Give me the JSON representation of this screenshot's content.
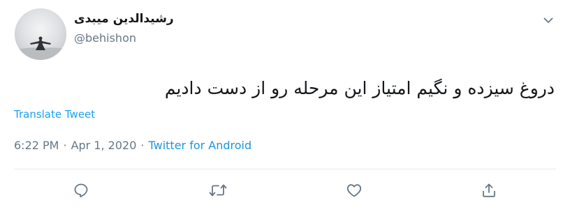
{
  "user": {
    "display_name": "رشیدالدین میبدی",
    "handle": "@behishon"
  },
  "tweet": {
    "text": "دروغ سیزده و نگیم امتیاز این مرحله رو از دست دادیم",
    "translate_label": "Translate Tweet",
    "time": "6:22 PM",
    "separator": "·",
    "date": "Apr 1, 2020",
    "source": "Twitter for Android"
  },
  "icons": {
    "more": "chevron-down-icon",
    "reply": "reply-icon",
    "retweet": "retweet-icon",
    "like": "heart-icon",
    "share": "share-icon"
  },
  "colors": {
    "text": "#14171a",
    "secondary": "#657786",
    "link": "#1da1f2",
    "divider": "#e6ecf0"
  }
}
